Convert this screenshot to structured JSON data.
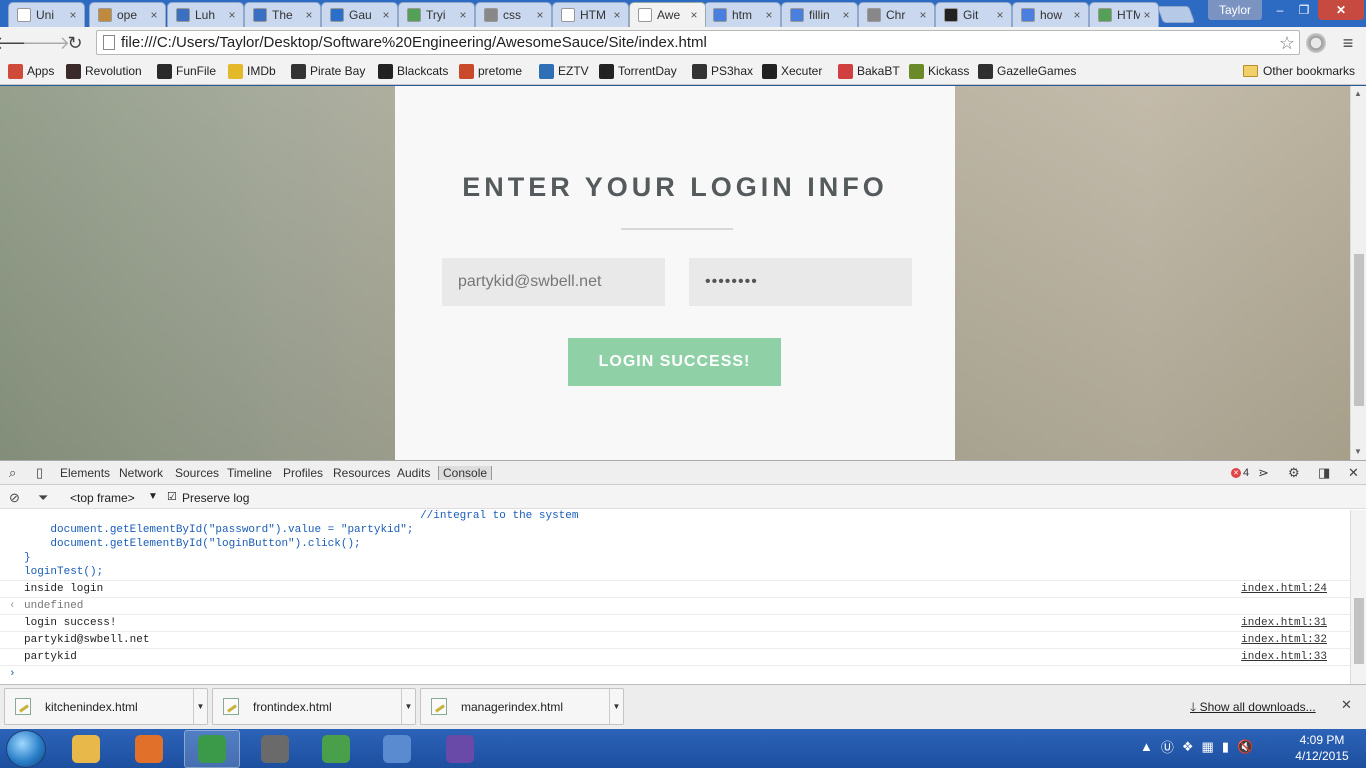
{
  "tabs": [
    {
      "title": "Uni",
      "icon": "page-icon",
      "color": "#ffffff"
    },
    {
      "title": "ope",
      "icon": "mcg-icon",
      "color": "#c08a3e"
    },
    {
      "title": "Luh",
      "icon": "house-icon",
      "color": "#3a6fc2"
    },
    {
      "title": "The",
      "icon": "cube-icon",
      "color": "#3a6fc2"
    },
    {
      "title": "Gau",
      "icon": "outlook-icon",
      "color": "#2a6fc9"
    },
    {
      "title": "Tryi",
      "icon": "chart-icon",
      "color": "#55a057"
    },
    {
      "title": "css",
      "icon": "stack-icon",
      "color": "#888888"
    },
    {
      "title": "HTM",
      "icon": "hg-icon",
      "color": "#ffffff"
    },
    {
      "title": "Awe",
      "icon": "page-icon",
      "color": "#ffffff"
    },
    {
      "title": "htm",
      "icon": "google-icon",
      "color": "#4a7fe0"
    },
    {
      "title": "fillin",
      "icon": "google-icon",
      "color": "#4a7fe0"
    },
    {
      "title": "Chr",
      "icon": "stack-icon",
      "color": "#888888"
    },
    {
      "title": "Git",
      "icon": "github-icon",
      "color": "#222222"
    },
    {
      "title": "how",
      "icon": "google-icon",
      "color": "#4a7fe0"
    },
    {
      "title": "HTM",
      "icon": "chart-icon",
      "color": "#55a057"
    }
  ],
  "profile_name": "Taylor",
  "address_url": "file:///C:/Users/Taylor/Desktop/Software%20Engineering/AwesomeSauce/Site/index.html",
  "bookmarks": [
    {
      "label": "Apps",
      "icon": "apps-grid-icon",
      "color": "#d04a3a"
    },
    {
      "label": "Revolution",
      "icon": "revolution-icon",
      "color": "#3a2a2a"
    },
    {
      "label": "FunFile",
      "icon": "funfile-icon",
      "color": "#2a2a2a"
    },
    {
      "label": "IMDb",
      "icon": "imdb-icon",
      "color": "#e3b92a"
    },
    {
      "label": "Pirate Bay",
      "icon": "ship-icon",
      "color": "#333333"
    },
    {
      "label": "Blackcats",
      "icon": "paw-icon",
      "color": "#222222"
    },
    {
      "label": "pretome",
      "icon": "pretome-icon",
      "color": "#c84a2a"
    },
    {
      "label": "EZTV",
      "icon": "eztv-icon",
      "color": "#2f6fb5"
    },
    {
      "label": "TorrentDay",
      "icon": "torrentday-icon",
      "color": "#222222"
    },
    {
      "label": "PS3hax",
      "icon": "ps3hax-icon",
      "color": "#333333"
    },
    {
      "label": "Xecuter",
      "icon": "xecuter-icon",
      "color": "#222222"
    },
    {
      "label": "BakaBT",
      "icon": "bakabt-icon",
      "color": "#d04040"
    },
    {
      "label": "Kickass",
      "icon": "kickass-icon",
      "color": "#6a8a2a"
    },
    {
      "label": "GazelleGames",
      "icon": "gazelle-icon",
      "color": "#2f2f2f"
    }
  ],
  "other_bookmarks": "Other bookmarks",
  "login": {
    "heading": "ENTER YOUR LOGIN INFO",
    "email_value": "partykid@swbell.net",
    "password_mask": "••••••••",
    "button_label": "LOGIN SUCCESS!",
    "button_color": "#8fd0a6"
  },
  "devtools": {
    "tabs": [
      "Elements",
      "Network",
      "Sources",
      "Timeline",
      "Profiles",
      "Resources",
      "Audits",
      "Console"
    ],
    "active_tab": "Console",
    "error_count": "4",
    "frame": "<top frame>",
    "preserve_log": "Preserve log",
    "console_lines": [
      {
        "text": "                                                            //integral to the system",
        "kind": "code"
      },
      {
        "text": "    document.getElementById(\"password\").value = \"partykid\";",
        "kind": "code"
      },
      {
        "text": "    document.getElementById(\"loginButton\").click();",
        "kind": "code"
      },
      {
        "text": "}",
        "kind": "code"
      },
      {
        "text": "loginTest();",
        "kind": "code"
      },
      {
        "text": "inside login",
        "kind": "log",
        "source": "index.html:24"
      },
      {
        "text": "undefined",
        "kind": "result"
      },
      {
        "text": "login success!",
        "kind": "log",
        "source": "index.html:31"
      },
      {
        "text": "partykid@swbell.net",
        "kind": "log",
        "source": "index.html:32"
      },
      {
        "text": "partykid",
        "kind": "log",
        "source": "index.html:33"
      }
    ]
  },
  "downloads": {
    "items": [
      "kitchenindex.html",
      "frontindex.html",
      "managerindex.html"
    ],
    "show_all": "Show all downloads..."
  },
  "taskbar": {
    "apps": [
      {
        "name": "explorer-icon",
        "color": "#e8b84a",
        "active": false
      },
      {
        "name": "firefox-icon",
        "color": "#e0702a",
        "active": false
      },
      {
        "name": "chrome-icon",
        "color": "#3b9a4a",
        "active": true
      },
      {
        "name": "media-player-icon",
        "color": "#6a6a6a",
        "active": false
      },
      {
        "name": "editor-icon",
        "color": "#4aa04a",
        "active": false
      },
      {
        "name": "control-panel-icon",
        "color": "#5a8ad0",
        "active": false
      },
      {
        "name": "github-desktop-icon",
        "color": "#6a4aa8",
        "active": false
      }
    ],
    "time": "4:09 PM",
    "date": "4/12/2015"
  }
}
